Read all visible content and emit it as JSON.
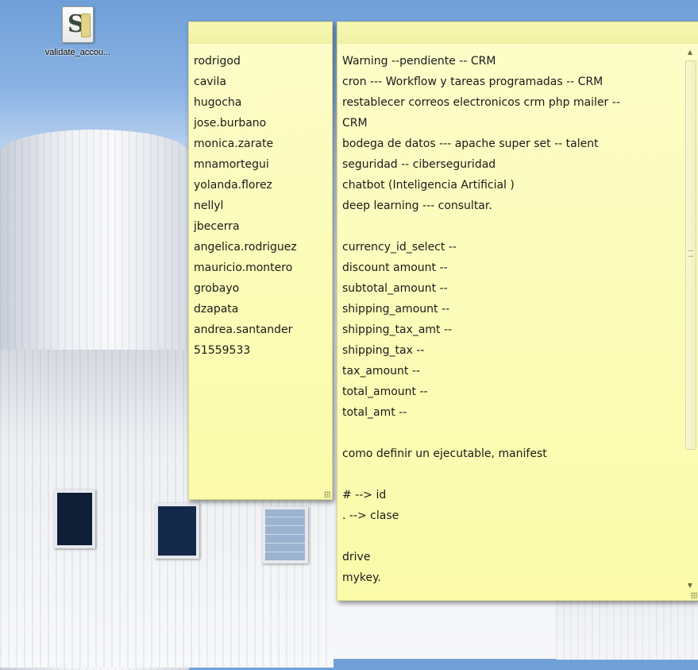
{
  "desktop": {
    "icon": {
      "name": "script-icon",
      "label": "validate_accou..."
    }
  },
  "note_users": {
    "lines": [
      "rodrigod",
      "cavila",
      "hugocha",
      "jose.burbano",
      "monica.zarate",
      "mnamortegui",
      "yolanda.florez",
      "nellyl",
      "jbecerra",
      "angelica.rodriguez",
      "mauricio.montero",
      "grobayo",
      "dzapata",
      "andrea.santander",
      "51559533"
    ]
  },
  "note_tasks": {
    "lines": [
      "Warning --pendiente -- CRM",
      "cron --- Workflow y tareas programadas -- CRM",
      "restablecer correos electronicos crm php mailer --",
      "CRM",
      "bodega de datos --- apache super set -- talent",
      "seguridad -- ciberseguridad",
      "chatbot (Inteligencia Artificial )",
      "deep learning --- consultar.",
      "",
      "currency_id_select --",
      "discount amount --",
      "subtotal_amount --",
      "shipping_amount --",
      "shipping_tax_amt --",
      "shipping_tax --",
      "tax_amount --",
      "total_amount --",
      "total_amt --",
      "",
      "como definir un ejecutable, manifest",
      "",
      "# --> id",
      ". --> clase",
      "",
      "drive",
      "mykey."
    ]
  },
  "colors": {
    "note_background": "#fbfbaa",
    "note_titlebar": "#f5f5ad"
  }
}
